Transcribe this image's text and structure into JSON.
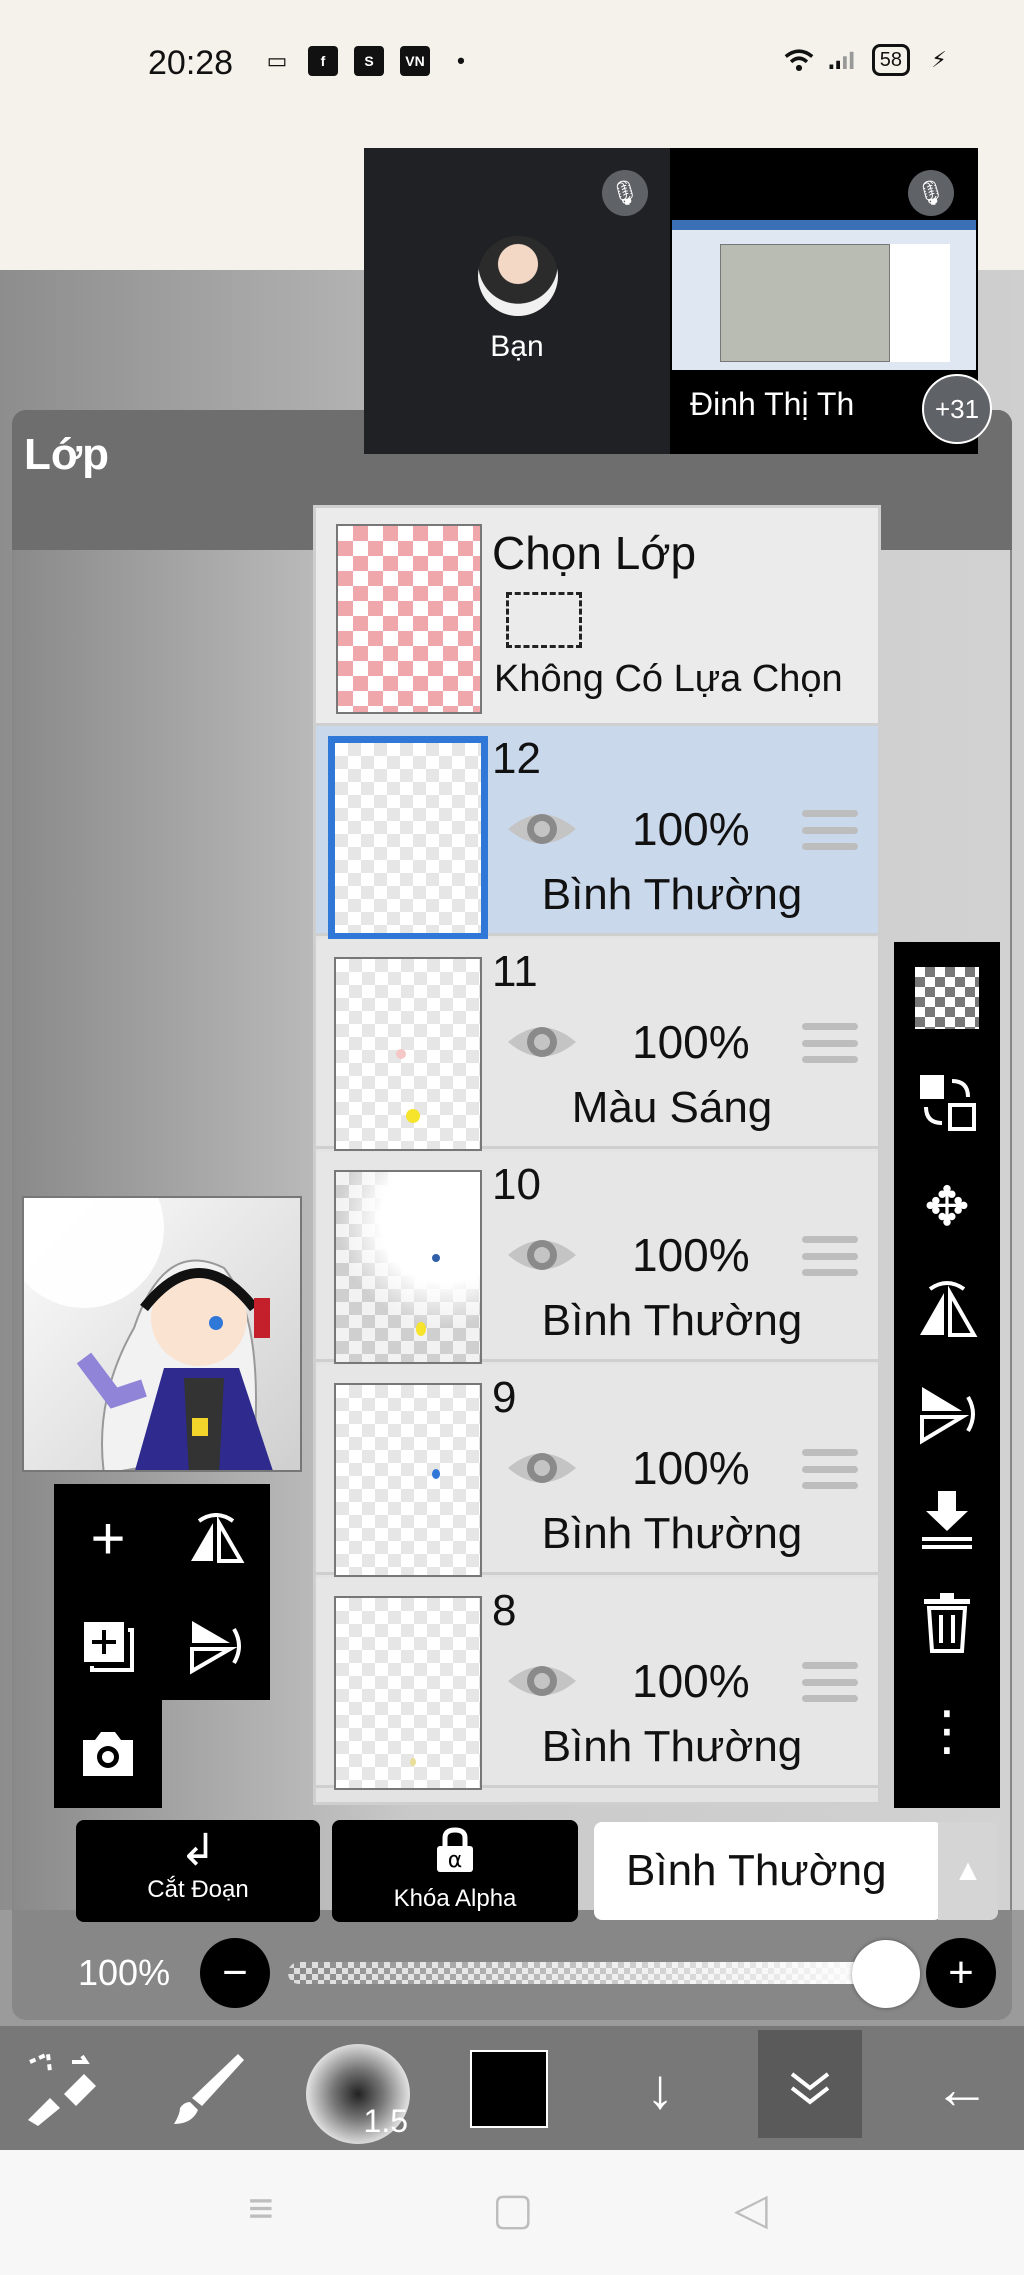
{
  "status_bar": {
    "time": "20:28",
    "left_icons": [
      "video-icon",
      "facebook-icon",
      "shopee-icon",
      "vnexpress-icon",
      "dot-icon"
    ],
    "battery": "58"
  },
  "panel": {
    "title": "Lớp"
  },
  "video_call": {
    "self_name": "Bạn",
    "other_name": "Đinh Thị Th",
    "more_count": "+31"
  },
  "selection_layer": {
    "title": "Chọn Lớp",
    "description": "Không Có Lựa Chọn"
  },
  "layers": [
    {
      "number": "12",
      "opacity": "100%",
      "blend": "Bình Thường",
      "selected": true
    },
    {
      "number": "11",
      "opacity": "100%",
      "blend": "Màu Sáng",
      "selected": false
    },
    {
      "number": "10",
      "opacity": "100%",
      "blend": "Bình Thường",
      "selected": false
    },
    {
      "number": "9",
      "opacity": "100%",
      "blend": "Bình Thường",
      "selected": false
    },
    {
      "number": "8",
      "opacity": "100%",
      "blend": "Bình Thường",
      "selected": false
    }
  ],
  "right_toolbar": [
    "checker-icon",
    "transfer-icon",
    "move-icon",
    "flip-horizontal-icon",
    "flip-vertical-icon",
    "merge-down-icon",
    "trash-icon",
    "more-vertical-icon"
  ],
  "buttons": {
    "clip": "Cắt Đoạn",
    "alpha_lock": "Khóa Alpha",
    "alpha_symbol": "α",
    "blend_mode": "Bình Thường"
  },
  "opacity": {
    "label": "100%",
    "value": 1.0
  },
  "bottom_toolbar": {
    "brush_size": "1.5",
    "color": "#000000"
  },
  "colors": {
    "selected_layer_bg": "#cad8ec",
    "selected_layer_border": "#2f78d8",
    "call_bg": "#202124"
  }
}
